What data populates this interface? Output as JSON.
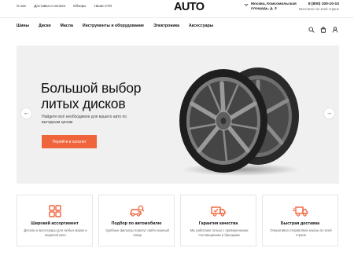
{
  "topbar": {
    "links": [
      "О нас",
      "Доставка и оплата",
      "Обзоры",
      "Наши СТО"
    ],
    "logo": "AUTO",
    "location": "Москва, Комсомольская площадь, д. 3",
    "phone": "8 (800) 100-10-10",
    "phone_note": "Бесплатно по всей стране"
  },
  "nav": {
    "items": [
      "Шины",
      "Диски",
      "Масла",
      "Инструменты и оборудование",
      "Электроника",
      "Аксессуары"
    ],
    "icons": [
      "search-icon",
      "cart-icon",
      "user-icon"
    ]
  },
  "hero": {
    "title": "Большой выбор литых дисков",
    "subtitle": "Найдите всё необходимое для вашего авто по выгодным ценам",
    "button": "Перейти в каталог",
    "prev": "←",
    "next": "→"
  },
  "features": [
    {
      "icon": "grid-icon",
      "title": "Широкий ассортимент",
      "desc": "Детали и аксессуары для любых марок и моделей авто"
    },
    {
      "icon": "car-search-icon",
      "title": "Подбор по автомобилю",
      "desc": "Удобные фильтры помогут найти нужный товар"
    },
    {
      "icon": "truck-check-icon",
      "title": "Гарантия качества",
      "desc": "Мы работаем только с проверенными поставщиками и брендами"
    },
    {
      "icon": "fast-truck-icon",
      "title": "Быстрая доставка",
      "desc": "Оперативно отправляем заказы по всей стране"
    }
  ],
  "colors": {
    "accent": "#f0643c",
    "hero_bg": "#f0f0f0"
  }
}
